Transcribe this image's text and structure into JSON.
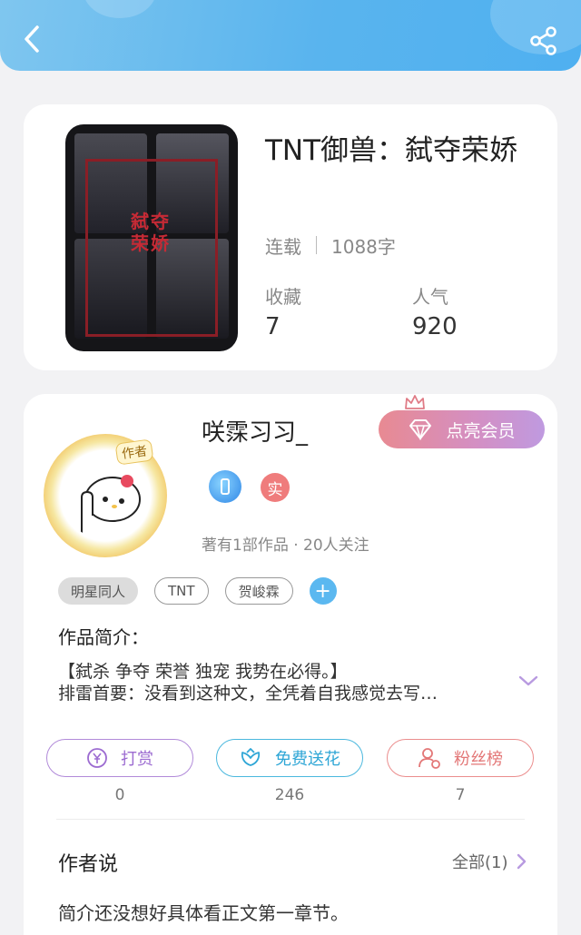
{
  "header": {
    "back_icon": "chevron-left-icon",
    "share_icon": "share-icon"
  },
  "book": {
    "title": "TNT御兽：弑夺荣娇",
    "cover_title": "弑夺荣娇",
    "status": "连载",
    "word_count": "1088字",
    "favorites_label": "收藏",
    "favorites_value": "7",
    "popularity_label": "人气",
    "popularity_value": "920"
  },
  "author": {
    "avatar_tag": "作者",
    "name": "咲霂习习_",
    "vip_button_label": "点亮会员",
    "badge_verified": "实",
    "works_line": "著有1部作品 · 20人关注"
  },
  "tags": [
    "明星同人",
    "TNT",
    "贺峻霖"
  ],
  "tag_add_label": "+",
  "intro": {
    "label": "作品简介：",
    "line1": "【弑杀 争夺 荣誉 独宠 我势在必得。】",
    "line2": "排雷首要：没看到这种文，全凭着自我感觉去写…"
  },
  "actions": {
    "reward": {
      "label": "打赏",
      "count": "0"
    },
    "flower": {
      "label": "免费送花",
      "count": "246"
    },
    "fans": {
      "label": "粉丝榜",
      "count": "7"
    }
  },
  "author_says": {
    "title": "作者说",
    "all_label": "全部(1)",
    "text": "简介还没想好具体看正文第一章节。"
  },
  "colors": {
    "header_blue": "#59b4ee",
    "reward_purple": "#9c6bd1",
    "flower_blue": "#2ea6d6",
    "fans_red": "#e37777"
  }
}
